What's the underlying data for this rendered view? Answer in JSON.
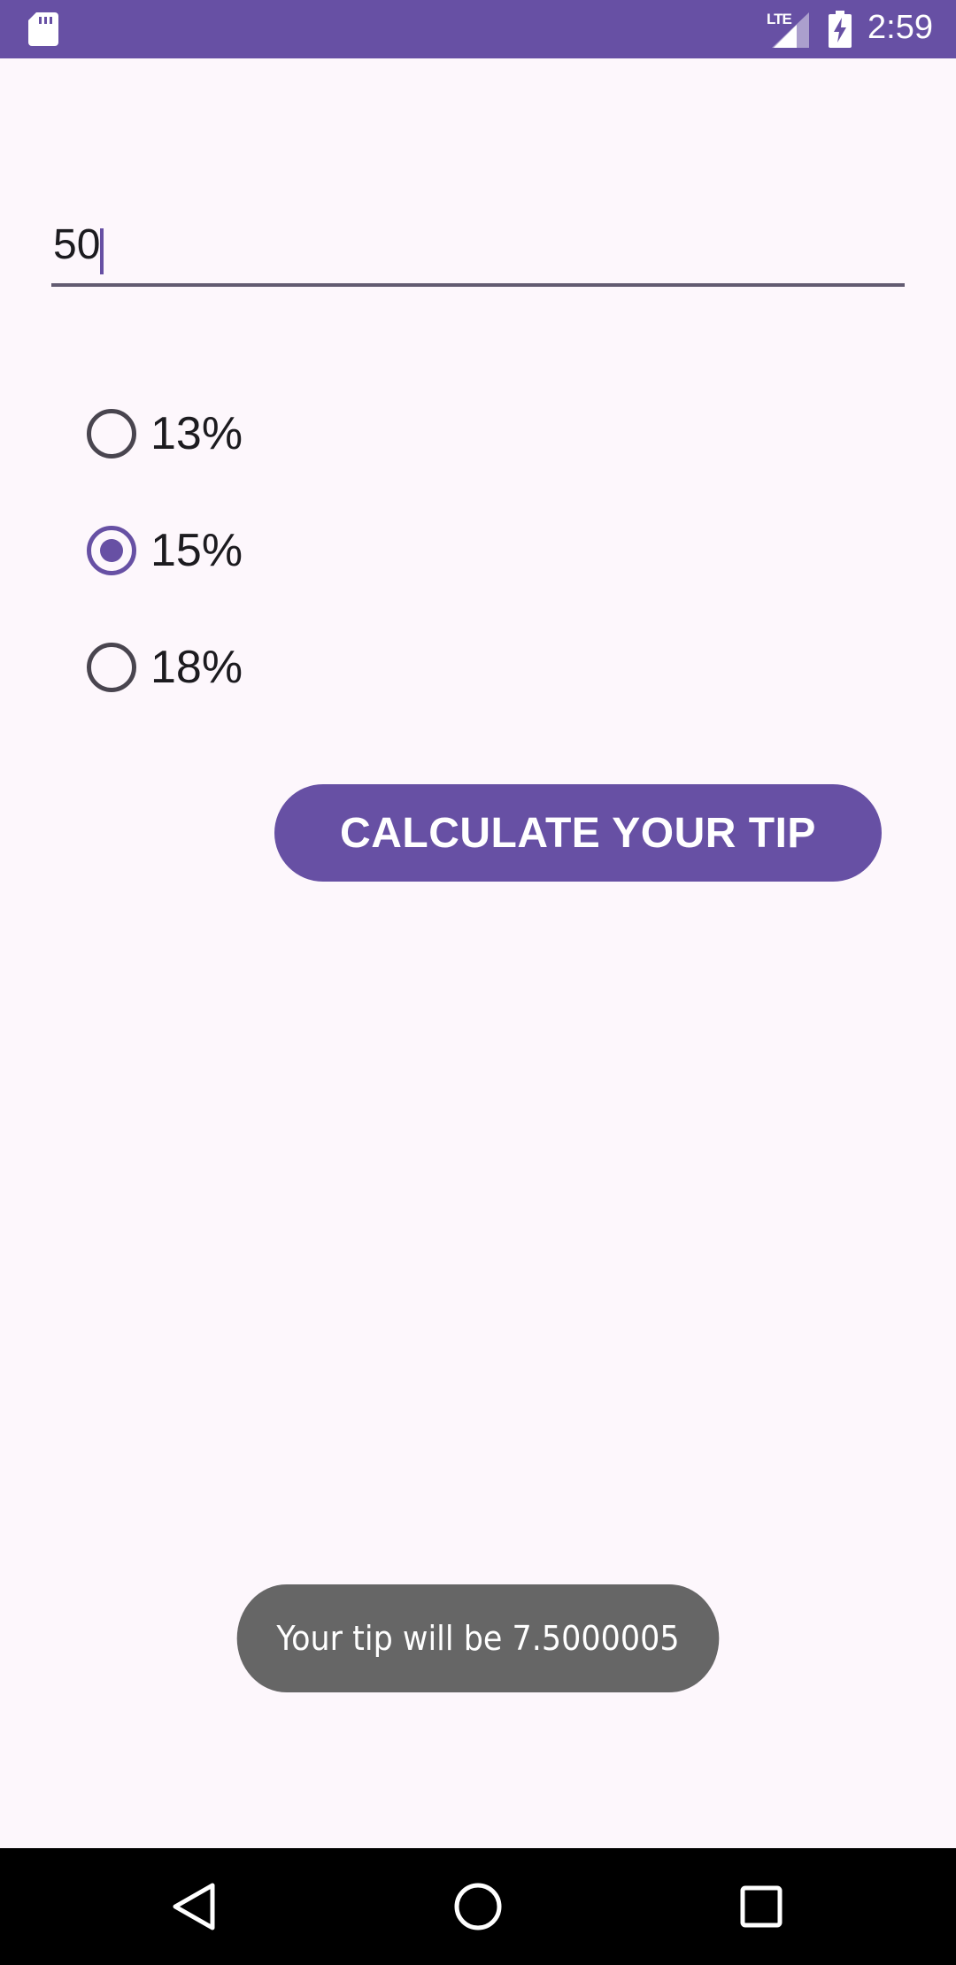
{
  "status_bar": {
    "time": "2:59",
    "network_label": "LTE",
    "icons": [
      "sd-card-icon",
      "signal-icon",
      "battery-charging-icon"
    ],
    "background_color": "#6750a4"
  },
  "bill_input": {
    "value": "50"
  },
  "tip_options": [
    {
      "label": "13%",
      "checked": false
    },
    {
      "label": "15%",
      "checked": true
    },
    {
      "label": "18%",
      "checked": false
    }
  ],
  "calculate_button": {
    "label": "CALCULATE YOUR TIP",
    "color": "#6750a4"
  },
  "toast": {
    "message": "Your tip will be 7.5000005"
  },
  "nav_bar": {
    "icons": [
      "back-icon",
      "home-icon",
      "recents-icon"
    ]
  }
}
